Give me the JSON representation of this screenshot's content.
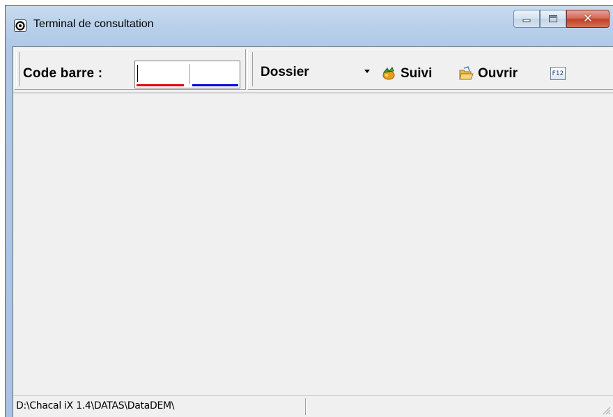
{
  "window": {
    "title": "Terminal de consultation",
    "app_icon": "app-c-icon",
    "buttons": [
      "minimize-icon",
      "maximize-icon",
      "close-icon"
    ]
  },
  "toolbar": {
    "barcode_label": "Code barre :",
    "barcode_value": "",
    "barcode_colors": [
      "#e60000",
      "#0000d8"
    ],
    "select_value": "Dossier",
    "suivi_label": "Suivi",
    "suivi_icon": "tracking-icon",
    "ouvrir_label": "Ouvrir",
    "ouvrir_icon": "open-folder-icon",
    "f12_label": "F12"
  },
  "statusbar": {
    "path": "D:\\Chacal iX 1.4\\DATAS\\DataDEM\\",
    "panel2": ""
  }
}
